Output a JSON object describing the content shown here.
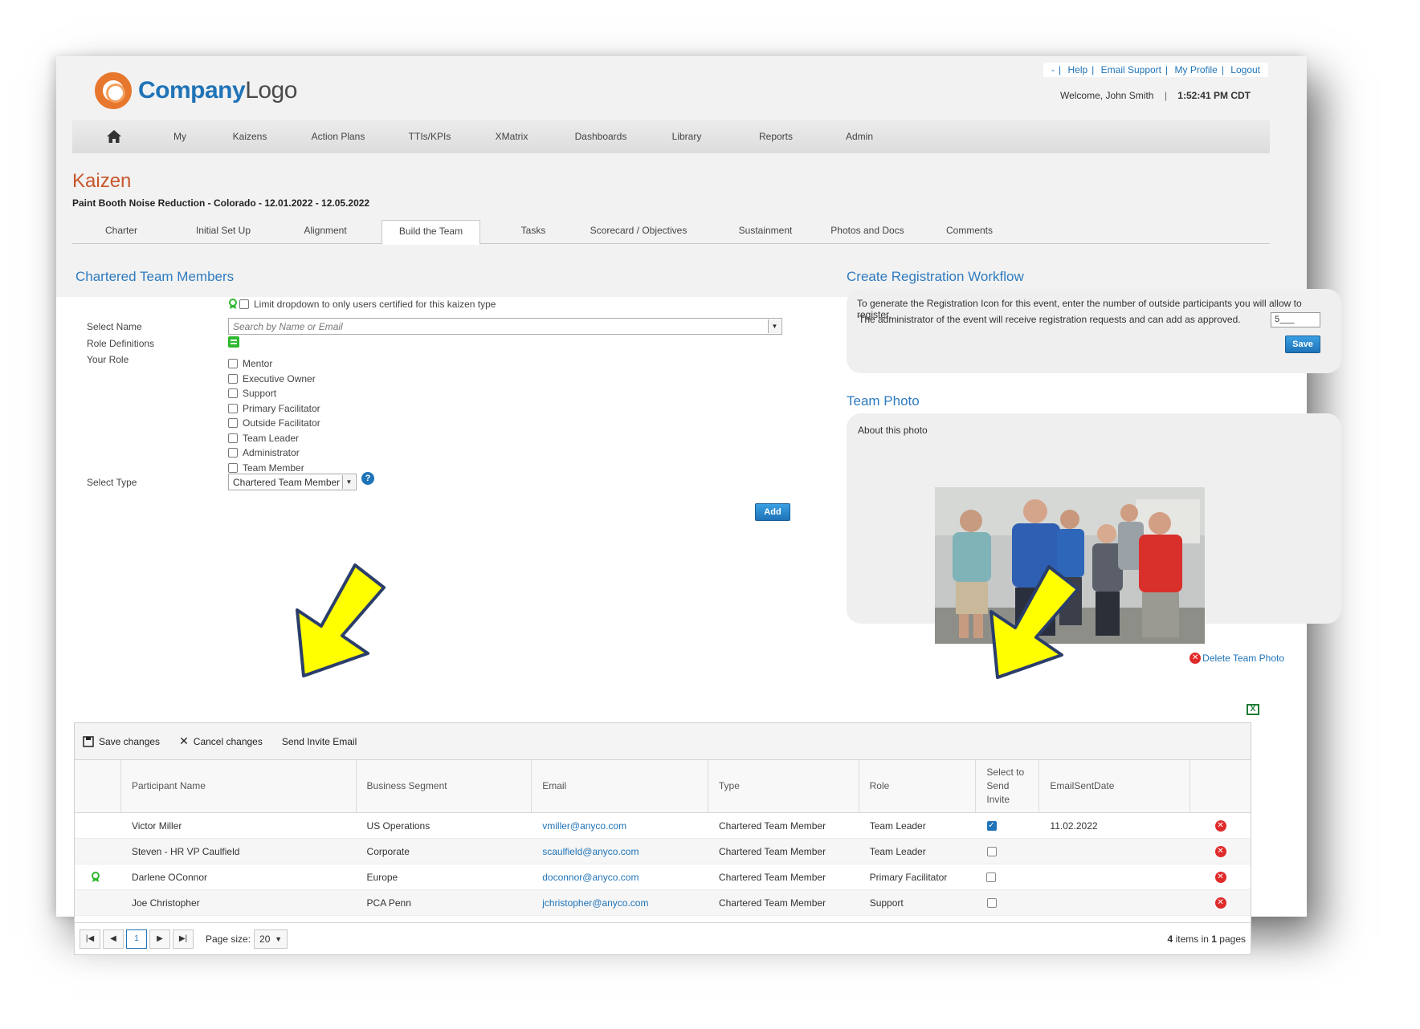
{
  "header": {
    "logo_bold": "Company",
    "logo_light": "Logo",
    "util_links": [
      "-",
      "Help",
      "Email Support",
      "My Profile",
      "Logout"
    ],
    "welcome": "Welcome, John Smith",
    "time": "1:52:41 PM CDT"
  },
  "nav": [
    "My",
    "Kaizens",
    "Action Plans",
    "TTIs/KPIs",
    "XMatrix",
    "Dashboards",
    "Library",
    "Reports",
    "Admin"
  ],
  "page": {
    "title": "Kaizen",
    "event": "Paint Booth Noise Reduction - Colorado - 12.01.2022 - 12.05.2022"
  },
  "tabs": [
    "Charter",
    "Initial Set Up",
    "Alignment",
    "Build the Team",
    "Tasks",
    "Scorecard / Objectives",
    "Sustainment",
    "Photos and Docs",
    "Comments"
  ],
  "active_tab": "Build the Team",
  "left": {
    "section_title": "Chartered Team Members",
    "limit_label": "Limit dropdown to only users certified for this kaizen type",
    "select_name_label": "Select Name",
    "search_placeholder": "Search by Name or Email",
    "role_def_label": "Role Definitions",
    "your_role_label": "Your Role",
    "roles": [
      "Mentor",
      "Executive Owner",
      "Support",
      "Primary Facilitator",
      "Outside Facilitator",
      "Team Leader",
      "Administrator",
      "Team Member"
    ],
    "select_type_label": "Select Type",
    "select_type_value": "Chartered Team Member",
    "add_button": "Add"
  },
  "registration": {
    "title": "Create Registration Workflow",
    "line1": "To generate the Registration Icon for this event, enter the number of outside participants you will allow to register.",
    "line2": "The administrator of the event will receive registration requests and can add as approved.",
    "count_value": "5___",
    "save_button": "Save"
  },
  "team_photo": {
    "title": "Team Photo",
    "about": "About this photo",
    "delete_label": "Delete Team Photo"
  },
  "grid": {
    "toolbar": {
      "save": "Save changes",
      "cancel": "Cancel changes",
      "send": "Send Invite Email"
    },
    "headers": [
      "",
      "Participant Name",
      "Business Segment",
      "Email",
      "Type",
      "Role",
      "Select to Send Invite",
      "EmailSentDate",
      ""
    ],
    "rows": [
      {
        "certified": false,
        "name": "Victor Miller",
        "segment": "US Operations",
        "email": "vmiller@anyco.com",
        "type": "Chartered Team Member",
        "role": "Team Leader",
        "selected": true,
        "sent": "11.02.2022"
      },
      {
        "certified": false,
        "name": "Steven - HR VP Caulfield",
        "segment": "Corporate",
        "email": "scaulfield@anyco.com",
        "type": "Chartered Team Member",
        "role": "Team Leader",
        "selected": false,
        "sent": ""
      },
      {
        "certified": true,
        "name": "Darlene OConnor",
        "segment": "Europe",
        "email": "doconnor@anyco.com",
        "type": "Chartered Team Member",
        "role": "Primary Facilitator",
        "selected": false,
        "sent": ""
      },
      {
        "certified": false,
        "name": "Joe Christopher",
        "segment": "PCA Penn",
        "email": "jchristopher@anyco.com",
        "type": "Chartered Team Member",
        "role": "Support",
        "selected": false,
        "sent": ""
      }
    ],
    "pager": {
      "current_page": "1",
      "page_size_label": "Page size:",
      "page_size": "20",
      "items_count": "4",
      "items_mid": "items in",
      "pages_count": "1",
      "pages_label": "pages"
    }
  },
  "colors": {
    "brand_blue": "#1f73b7",
    "accent_orange": "#e8772e",
    "title_rust": "#c8562a",
    "delete_red": "#e02b2b",
    "arrow_yellow": "#ffff00"
  }
}
